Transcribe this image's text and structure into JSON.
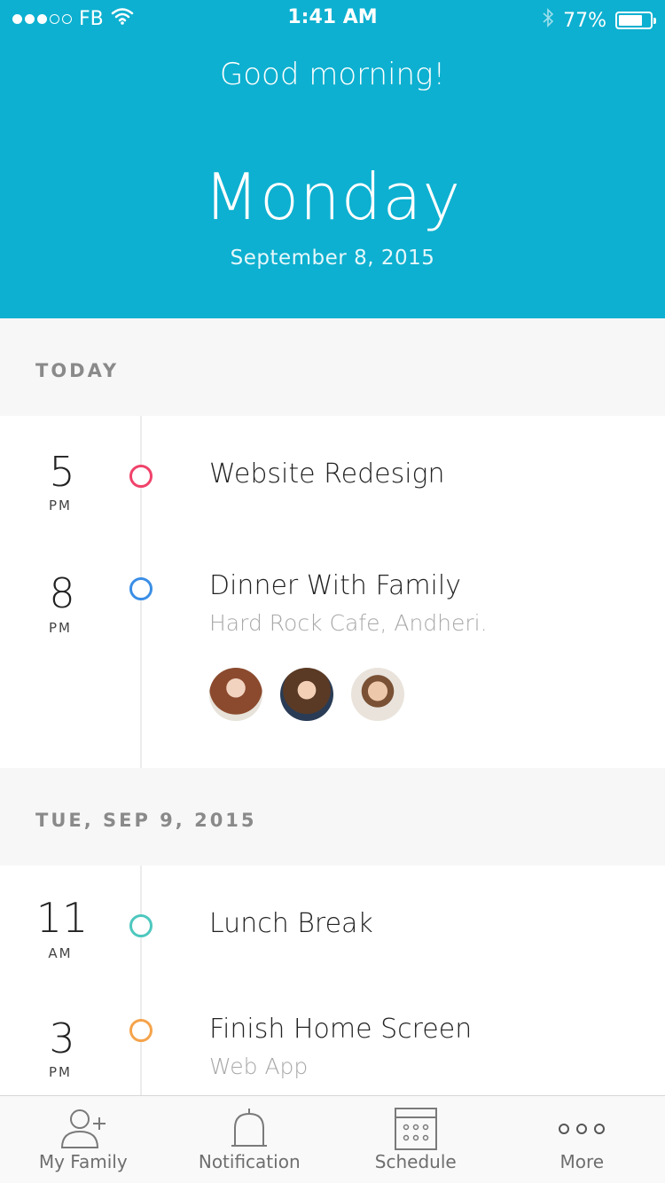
{
  "status_bar": {
    "carrier": "FB",
    "time": "1:41 AM",
    "battery": "77%",
    "battery_level": 0.77
  },
  "header": {
    "greeting": "Good morning!",
    "day": "Monday",
    "date": "September 8, 2015",
    "background": "#0db0d0"
  },
  "sections": [
    {
      "label": "TODAY",
      "events": [
        {
          "hour": "5",
          "ampm": "PM",
          "title": "Website Redesign",
          "subtitle": "",
          "color": "#f0426a"
        },
        {
          "hour": "8",
          "ampm": "PM",
          "title": "Dinner With Family",
          "subtitle": "Hard Rock Cafe, Andheri.",
          "color": "#3a8ee6",
          "attendees": [
            "attendee-1",
            "attendee-2",
            "attendee-3"
          ]
        }
      ]
    },
    {
      "label": "TUE, SEP 9, 2015",
      "events": [
        {
          "hour": "11",
          "ampm": "AM",
          "title": "Lunch Break",
          "subtitle": "",
          "color": "#4dc7be"
        },
        {
          "hour": "3",
          "ampm": "PM",
          "title": "Finish Home Screen",
          "subtitle": "Web App",
          "color": "#f5a34a"
        }
      ]
    }
  ],
  "tabbar": {
    "items": [
      {
        "label": "My Family",
        "icon": "add-user-icon"
      },
      {
        "label": "Notification",
        "icon": "bell-icon"
      },
      {
        "label": "Schedule",
        "icon": "calendar-icon"
      },
      {
        "label": "More",
        "icon": "more-icon"
      }
    ]
  }
}
